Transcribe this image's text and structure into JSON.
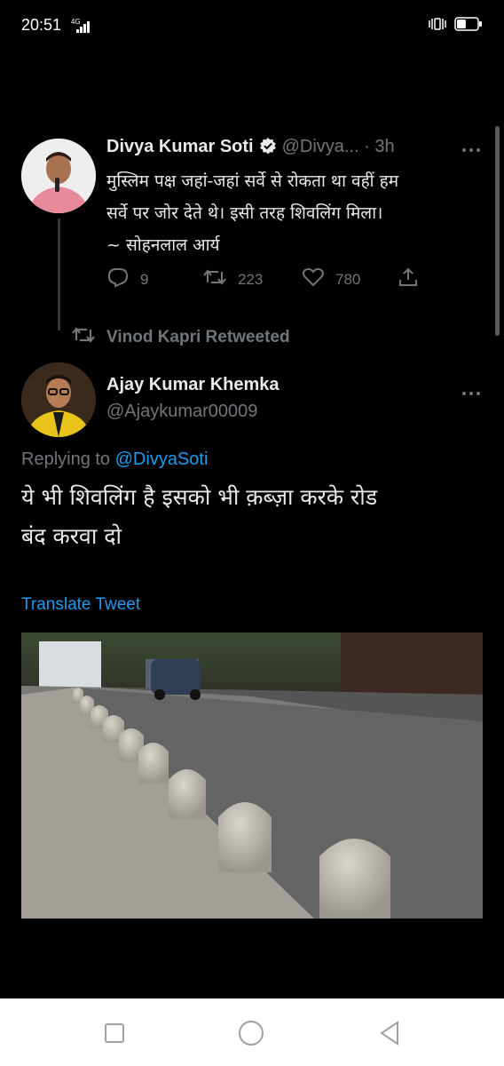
{
  "status_bar": {
    "time": "20:51",
    "network": "4G",
    "battery_level": 0.45
  },
  "tweet1": {
    "author_name": "Divya Kumar Soti",
    "handle_time": "@Divya... · 3h",
    "text_lines": [
      "मुस्लिम पक्ष जहां-जहां सर्वे से रोकता था वहीं हम",
      "सर्वे पर जोर देते थे। इसी तरह शिवलिंग मिला।",
      "~ सोहनलाल आर्य"
    ],
    "reply_count": "9",
    "retweet_count": "223",
    "like_count": "780",
    "more_icon": "more-dots-icon"
  },
  "retweet_banner": {
    "label": "Vinod Kapri Retweeted",
    "icon": "retweet-icon"
  },
  "tweet2": {
    "author_name": "Ajay Kumar Khemka",
    "handle": "@Ajaykumar00009",
    "reply_prefix": "Replying to ",
    "reply_mention": "@DivyaSoti",
    "text_lines": [
      "ये भी शिवलिंग है इसको भी क़ब्ज़ा करके रोड",
      "बंद करवा दो"
    ],
    "translate_label": "Translate Tweet"
  },
  "colors": {
    "background": "#000000",
    "text": "#e7e9ea",
    "muted": "#71767b",
    "link": "#1d9bf0",
    "verified": "#e7e9ea"
  },
  "nav_bar": {
    "recents_icon": "square-icon",
    "home_icon": "circle-icon",
    "back_icon": "triangle-back-icon"
  }
}
